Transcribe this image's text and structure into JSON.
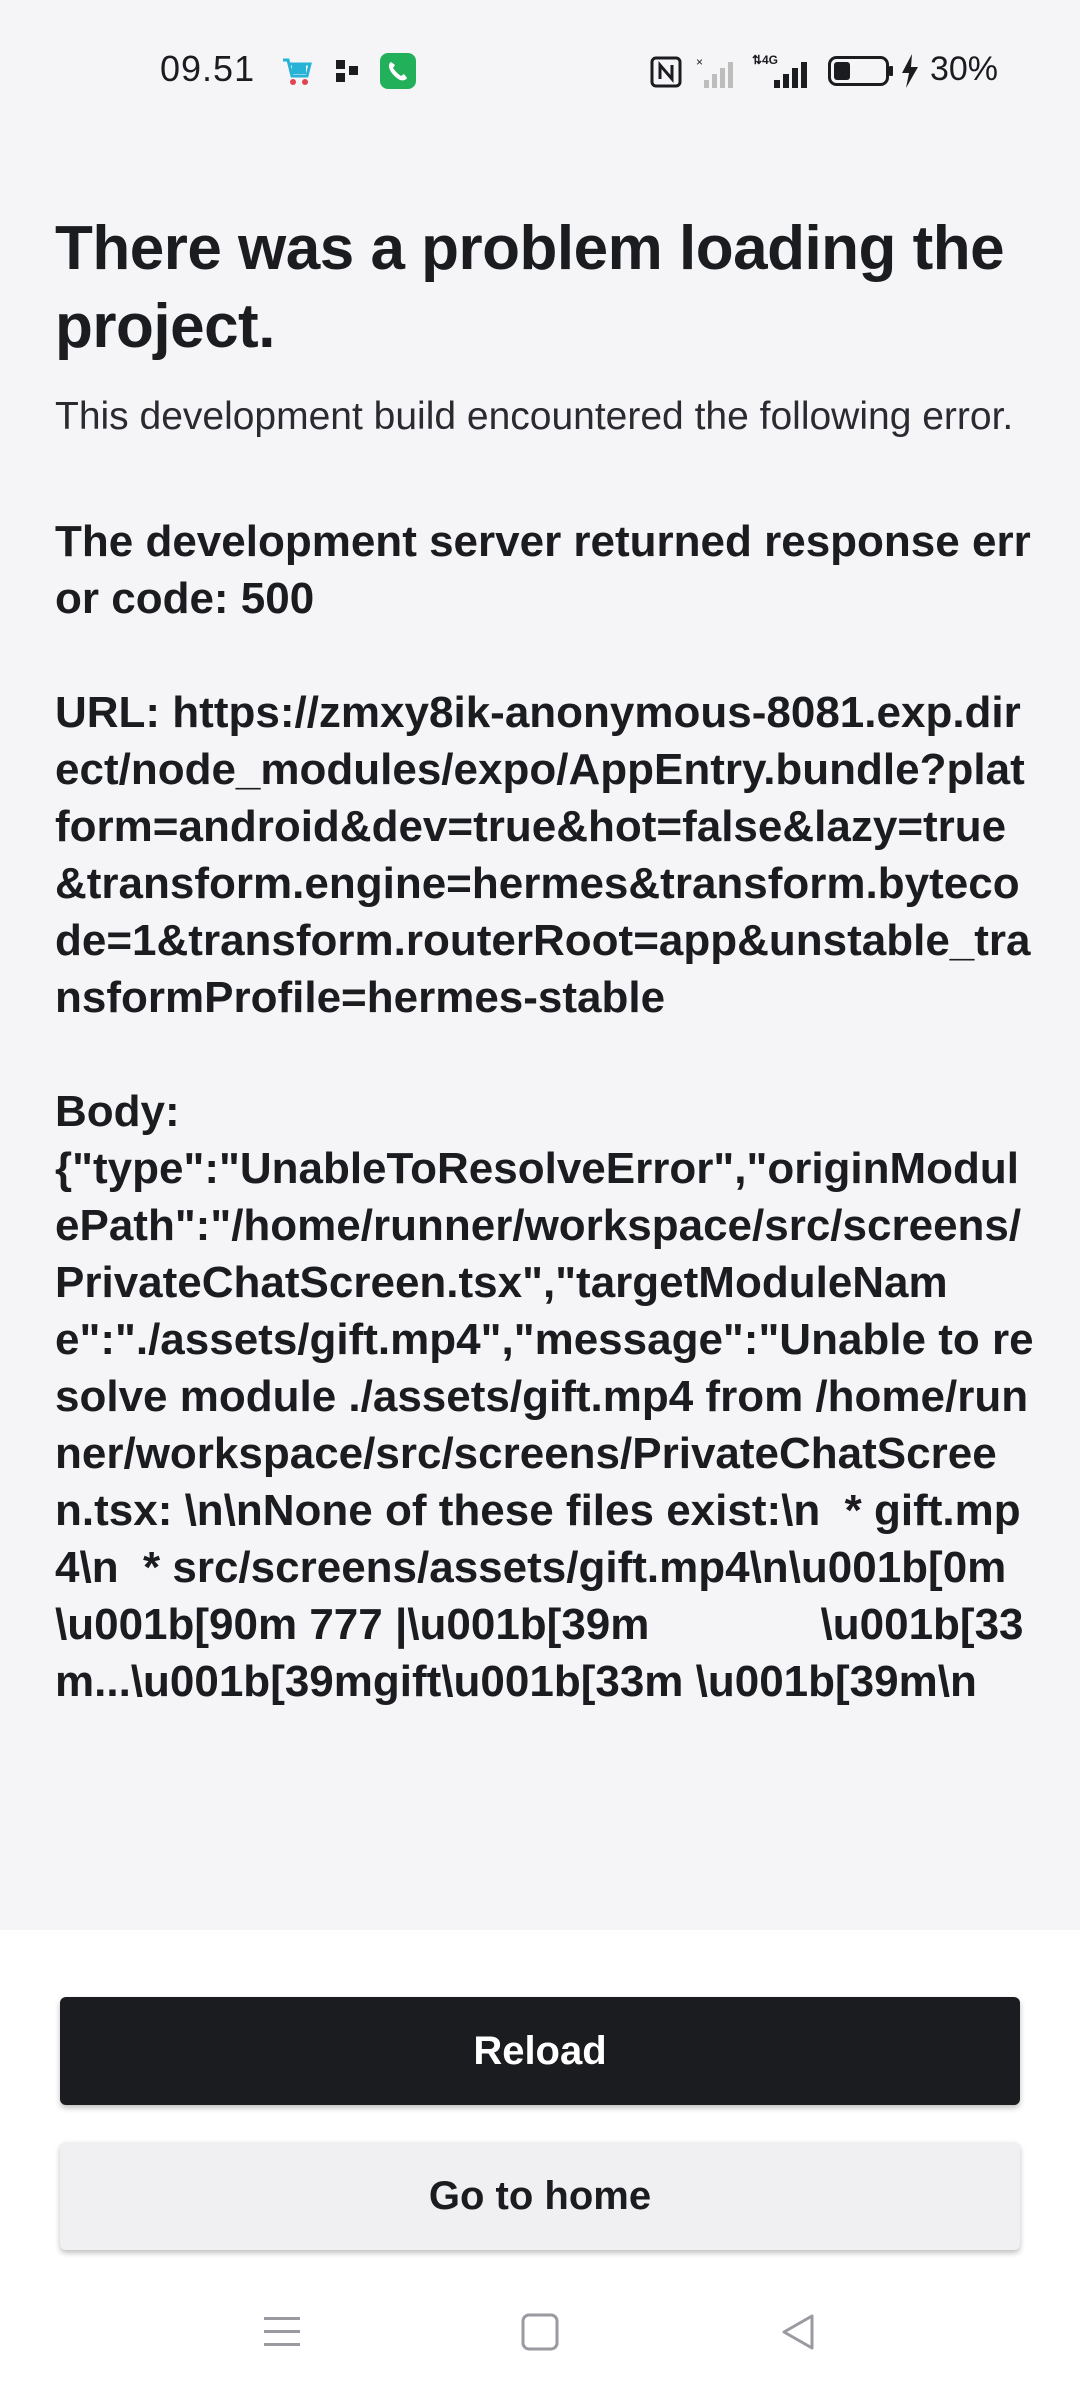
{
  "status_bar": {
    "time": "09.51",
    "battery_percent": "30%",
    "network": "4G",
    "icons": [
      "shopping-app-icon",
      "dots-icon",
      "phone-app-icon",
      "nfc-icon",
      "sim1-no-signal-icon",
      "sim2-signal-icon",
      "battery-icon",
      "charging-icon"
    ]
  },
  "error": {
    "title": "There was a problem loading the project.",
    "subtitle": "This development build encountered the following error.",
    "message": "The development server returned response error code: 500\n\nURL: https://zmxy8ik-anonymous-8081.exp.direct/node_modules/expo/AppEntry.bundle?platform=android&dev=true&hot=false&lazy=true&transform.engine=hermes&transform.bytecode=1&transform.routerRoot=app&unstable_transformProfile=hermes-stable\n\nBody:\n{\"type\":\"UnableToResolveError\",\"originModulePath\":\"/home/runner/workspace/src/screens/PrivateChatScreen.tsx\",\"targetModuleName\":\"./assets/gift.mp4\",\"message\":\"Unable to resolve module ./assets/gift.mp4 from /home/runner/workspace/src/screens/PrivateChatScreen.tsx: \\n\\nNone of these files exist:\\n  * gift.mp4\\n  * src/screens/assets/gift.mp4\\n\\u001b[0m \\u001b[90m 777 |\\u001b[39m              \\u001b[33m...\\u001b[39mgift\\u001b[33m \\u001b[39m\\n"
  },
  "actions": {
    "reload_label": "Reload",
    "home_label": "Go to home"
  },
  "nav": {
    "icons": [
      "menu-icon",
      "home-square-icon",
      "back-triangle-icon"
    ]
  }
}
